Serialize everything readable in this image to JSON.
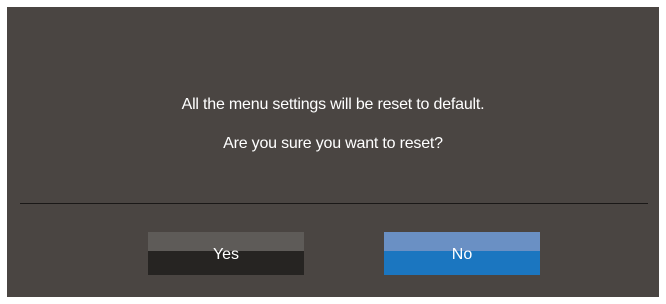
{
  "dialog": {
    "message_line1": "All the menu settings will be reset to default.",
    "message_line2": "Are you sure you want to reset?",
    "buttons": {
      "yes_label": "Yes",
      "no_label": "No",
      "selected": "No"
    },
    "colors": {
      "background": "#4a4542",
      "selected_button": "#1b76c0",
      "unselected_button": "#262422",
      "text": "#ffffff"
    }
  }
}
